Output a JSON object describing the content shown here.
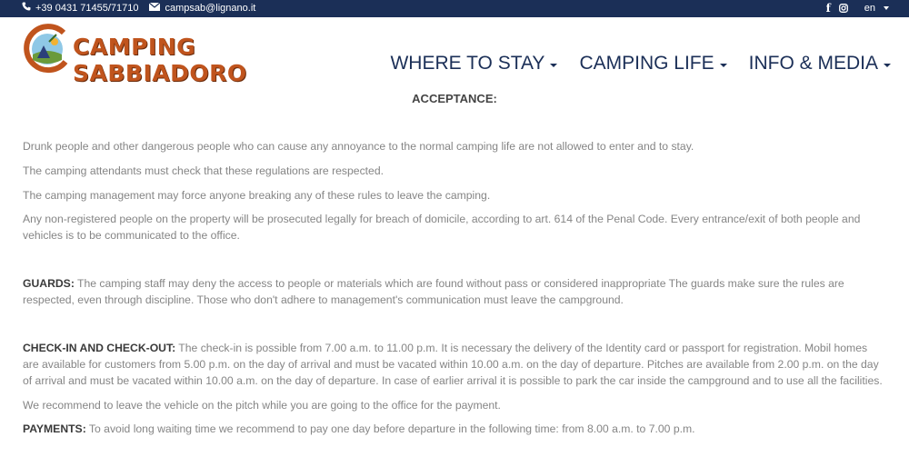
{
  "topbar": {
    "phone": "+39 0431 71455/71710",
    "email": "campsab@lignano.it",
    "icons": [
      "phone-icon",
      "envelope-icon",
      "facebook-icon",
      "instagram-icon"
    ],
    "language": "en"
  },
  "logo": {
    "text": "CAMPING SABBIADORO"
  },
  "nav": {
    "items": [
      {
        "label": "WHERE TO STAY"
      },
      {
        "label": "CAMPING LIFE"
      },
      {
        "label": "INFO & MEDIA"
      }
    ]
  },
  "page": {
    "heading": "ACCEPTANCE:",
    "p1": "Drunk people and other dangerous people who can cause any annoyance to the normal camping life are not allowed to enter and to stay.",
    "p2": "The camping attendants must check that these regulations are respected.",
    "p3": "The camping management may force anyone breaking any of these rules to leave the camping.",
    "p4": "Any non-registered people on the property will be prosecuted legally for breach of domicile, according to art. 614 of the Penal Code.  Every entrance/exit of both people and vehicles is to be communicated to the office.",
    "guards_label": "GUARDS:",
    "guards_text": " The camping staff may deny the access to people or materials which are found without pass or considered inappropriate The guards  make sure the rules are respected, even through discipline. Those who don't adhere to management's communication must leave the campground.",
    "checkin_label": "CHECK-IN AND CHECK-OUT:",
    "checkin_text": " The check-in is possible from 7.00 a.m. to 11.00 p.m. It is necessary the delivery of the Identity card or passport for registration. Mobil homes are available for customers from 5.00 p.m. on the day of arrival and must be vacated within 10.00 a.m. on the day of departure. Pitches are available from 2.00 p.m. on the  day of arrival and must be vacated within 10.00 a.m.  on the day of departure. In case of earlier arrival it is possible to park the car inside the campground and to use all the facilities.",
    "p7": "We recommend to leave the vehicle on the pitch while you are going to the office for the payment.",
    "payments_label": "PAYMENTS:",
    "payments_text": " To avoid long waiting time we recommend to pay one day before departure in the following time: from 8.00 a.m. to 7.00 p.m."
  }
}
